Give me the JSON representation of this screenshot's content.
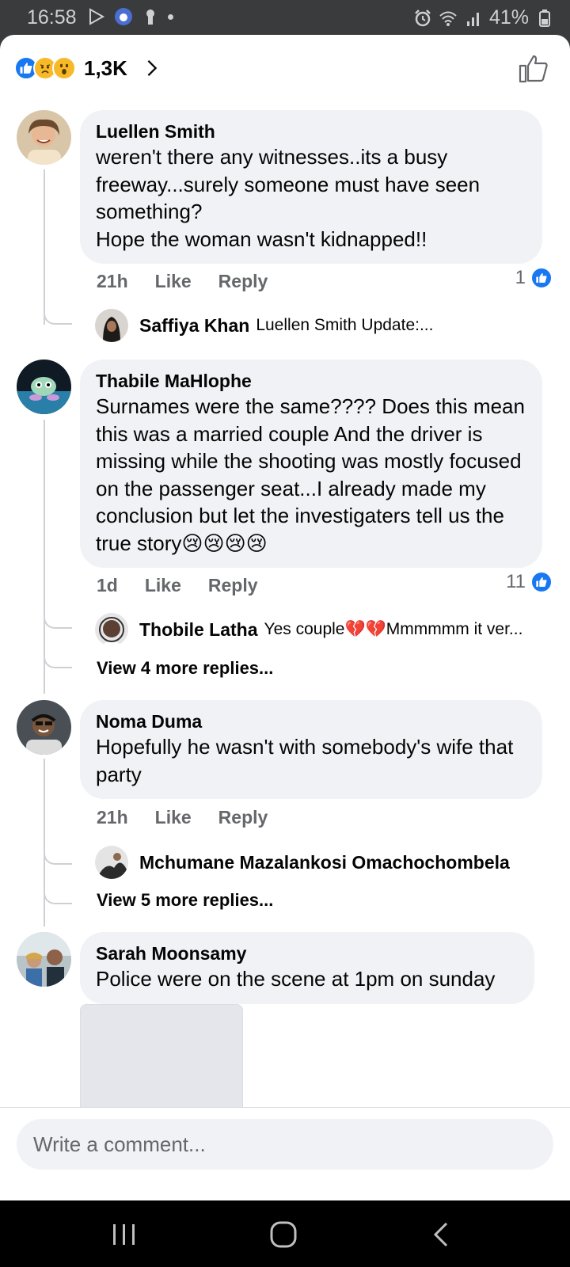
{
  "status_bar": {
    "time": "16:58",
    "battery": "41%",
    "icons": [
      "play-store-icon",
      "news-app-icon",
      "keyhole-icon",
      "notification-dot-icon",
      "alarm-icon",
      "wifi-icon",
      "signal-icon",
      "battery-icon"
    ]
  },
  "reactions": {
    "count": "1,3K",
    "types": [
      "like",
      "sad",
      "wow"
    ]
  },
  "comments": [
    {
      "author": "Luellen Smith",
      "text": "weren't there any witnesses..its a busy freeway...surely someone must have seen something?\nHope the woman wasn't kidnapped!!",
      "time": "21h",
      "like_label": "Like",
      "reply_label": "Reply",
      "likes": "1",
      "replies": [
        {
          "author": "Saffiya Khan",
          "preview": "Luellen Smith Update:..."
        }
      ]
    },
    {
      "author": "Thabile MaHlophe",
      "text": "Surnames were the same???? Does this mean this was a married couple And the driver is missing while the shooting was mostly focused on the passenger seat...I already made my conclusion but let the investigaters tell us the true story😢😢😢😢",
      "time": "1d",
      "like_label": "Like",
      "reply_label": "Reply",
      "likes": "11",
      "replies": [
        {
          "author": "Thobile Latha",
          "preview": "Yes couple💔💔Mmmmmm it ver..."
        }
      ],
      "more_replies": "View 4 more replies..."
    },
    {
      "author": "Noma Duma",
      "text": "Hopefully he wasn't with somebody's wife that party",
      "time": "21h",
      "like_label": "Like",
      "reply_label": "Reply",
      "replies": [
        {
          "author": "Mchumane Mazalankosi Omachochombela",
          "preview": ""
        }
      ],
      "more_replies": "View 5 more replies..."
    },
    {
      "author": "Sarah Moonsamy",
      "text": "Police were on the scene at 1pm on sunday"
    }
  ],
  "composer": {
    "placeholder": "Write a comment..."
  },
  "nav": {
    "icons": [
      "recent-apps-icon",
      "home-icon",
      "back-icon"
    ]
  },
  "colors": {
    "facebook_blue": "#1877f2",
    "bubble_bg": "#f0f2f5",
    "secondary_text": "#65676b"
  }
}
